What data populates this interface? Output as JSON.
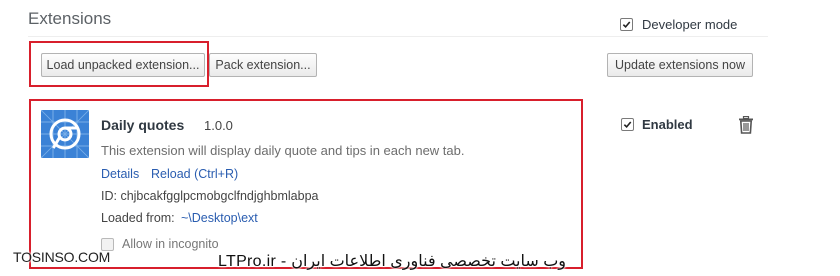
{
  "header": {
    "title": "Extensions",
    "developer_mode": {
      "label": "Developer mode",
      "checked": true
    }
  },
  "toolbar": {
    "load_unpacked_label": "Load unpacked extension...",
    "pack_label": "Pack extension...",
    "update_label": "Update extensions now"
  },
  "extension": {
    "name": "Daily quotes",
    "version": "1.0.0",
    "description": "This extension will display daily quote and tips in each new tab.",
    "details_label": "Details",
    "reload_label": "Reload (Ctrl+R)",
    "id_text": "ID: chjbcakfgglpcmobgclfndjghbmlabpa",
    "loaded_from_label": "Loaded from:",
    "loaded_from_path": "~\\Desktop\\ext",
    "incognito_label": "Allow in incognito",
    "incognito_checked": false,
    "enabled_label": "Enabled",
    "enabled_checked": true
  },
  "watermark": {
    "left": "TOSINSO.COM",
    "right": "LTPro.ir - وب سایت تخصصی فناوری اطلاعات ایران"
  },
  "colors": {
    "highlight_border": "#d81f2c",
    "link": "#2a5db0",
    "icon_blue": "#3b82d6"
  }
}
